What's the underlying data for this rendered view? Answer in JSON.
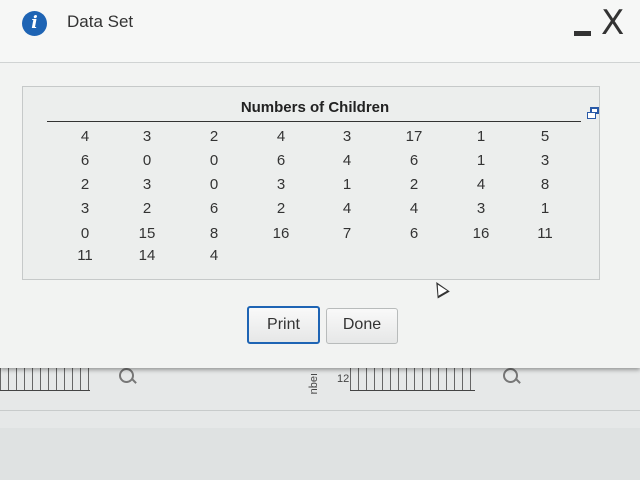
{
  "dialog": {
    "title": "Data Set",
    "icon": "info-icon",
    "minimize_icon": "minimize-icon",
    "close_symbol": "X"
  },
  "table": {
    "title": "Numbers of Children",
    "expand_icon": "expand-icon",
    "columns": [
      [
        "4",
        "6",
        "2",
        "3",
        "0",
        "11"
      ],
      [
        "3",
        "0",
        "3",
        "2",
        "15",
        "14"
      ],
      [
        "2",
        "0",
        "0",
        "6",
        "8",
        "4"
      ],
      [
        "4",
        "6",
        "3",
        "2",
        "16"
      ],
      [
        "3",
        "4",
        "1",
        "4",
        "7"
      ],
      [
        "17",
        "6",
        "2",
        "4",
        "6"
      ],
      [
        "1",
        "1",
        "4",
        "3",
        "16"
      ],
      [
        "5",
        "3",
        "8",
        "1",
        "11"
      ]
    ]
  },
  "buttons": {
    "print": "Print",
    "done": "Done"
  },
  "background": {
    "graph_label": "ıəqu",
    "graph_ticks": "12"
  },
  "colors": {
    "accent": "#1e64b4",
    "window": "#f2f3f2",
    "panel": "#eceeed"
  }
}
